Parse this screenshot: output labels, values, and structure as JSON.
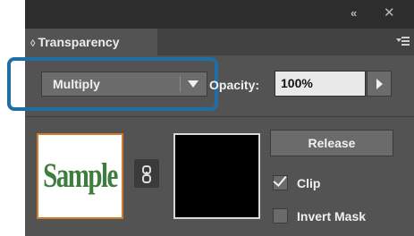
{
  "window": {
    "collapse_glyph": "«",
    "close_glyph": "✕"
  },
  "panel": {
    "tab_diamond": "◊",
    "tab_label": "Transparency",
    "menu_icon": "panel-menu-icon"
  },
  "blend_mode": {
    "selected": "Multiply"
  },
  "opacity": {
    "label": "Opacity:",
    "value": "100%"
  },
  "thumbnails": {
    "artwork_text": "Sample"
  },
  "buttons": {
    "release": "Release"
  },
  "options": {
    "clip": {
      "label": "Clip",
      "checked": true
    },
    "invert_mask": {
      "label": "Invert Mask",
      "checked": false
    }
  },
  "colors": {
    "highlight": "#1f6ea6",
    "thumb_border": "#d27b2d",
    "sample_text": "#3d7d3e"
  }
}
